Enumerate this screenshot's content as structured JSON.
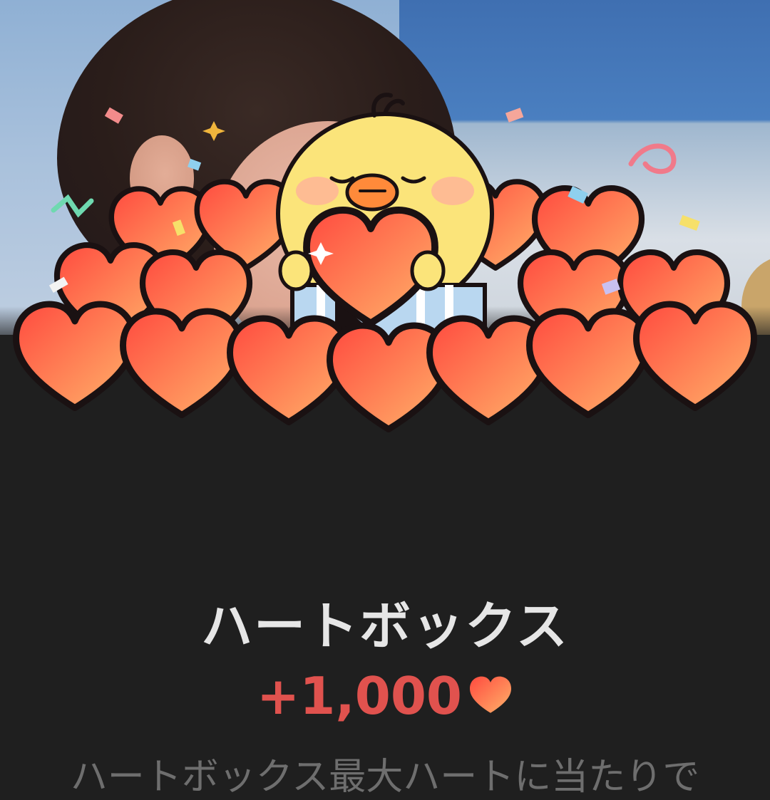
{
  "title": "ハートボックス",
  "reward": {
    "amount": "+1,000",
    "currency_icon": "heart-icon"
  },
  "description": "ハートボックス最大ハートに当たりで",
  "colors": {
    "background": "#1f1f1f",
    "title_text": "#e6e6e6",
    "reward_text": "#e0524e",
    "heart_fill_start": "#ff5a4a",
    "heart_fill_end": "#ffb070"
  }
}
